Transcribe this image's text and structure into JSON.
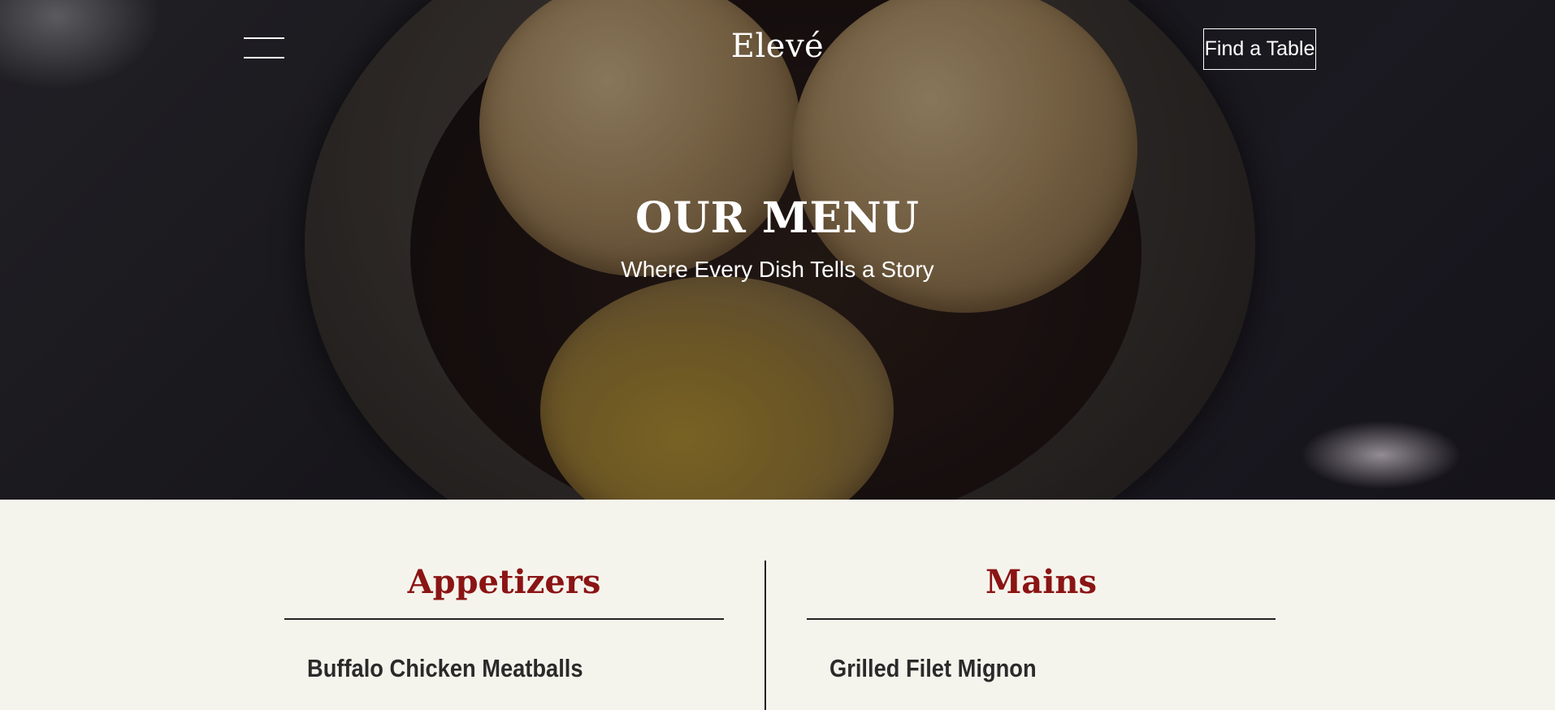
{
  "header": {
    "brand": "Elevé",
    "cta_label": "Find a Table",
    "menu_icon": "hamburger-menu-icon"
  },
  "hero": {
    "title": "OUR MENU",
    "subtitle": "Where Every Dish Tells a Story"
  },
  "menu": {
    "categories": [
      {
        "title": "Appetizers",
        "items": [
          {
            "name": "Buffalo Chicken Meatballs",
            "description": ""
          }
        ]
      },
      {
        "title": "Mains",
        "items": [
          {
            "name": "Grilled Filet Mignon",
            "description": ""
          }
        ]
      }
    ]
  },
  "colors": {
    "accent": "#8b1414",
    "page_background": "#f5f4ec",
    "text": "#2a2a2a"
  }
}
